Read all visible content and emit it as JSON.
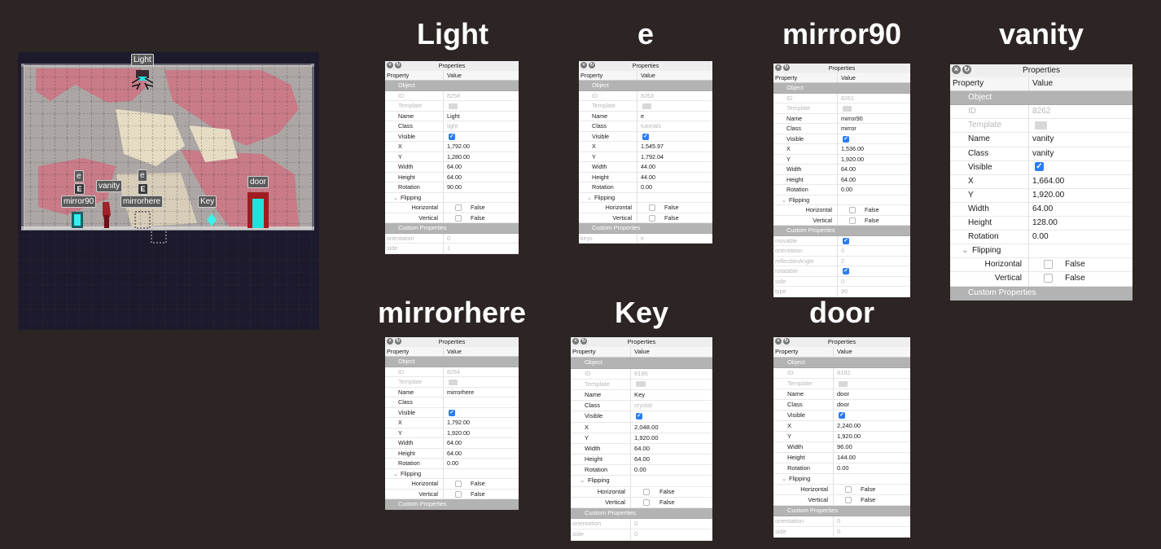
{
  "map": {
    "labels": {
      "light": "Light",
      "e1": "e",
      "e2": "e",
      "key_hint1": "E",
      "key_hint2": "E",
      "vanity": "vanity",
      "mirror90": "mirror90",
      "mirrorhere": "mirrorhere",
      "key": "Key",
      "door": "door"
    },
    "colors": {
      "bg": "#1c1a2c",
      "wall": "#aca7a4",
      "pink": "#c97b88",
      "cream": "#e6dcc4"
    }
  },
  "common": {
    "window_title": "Properties",
    "col_property": "Property",
    "col_value": "Value",
    "sec_object": "Object",
    "sec_custom": "Custom Properties",
    "l_id": "ID",
    "l_template": "Template",
    "l_name": "Name",
    "l_class": "Class",
    "l_visible": "Visible",
    "l_x": "X",
    "l_y": "Y",
    "l_width": "Width",
    "l_height": "Height",
    "l_rotation": "Rotation",
    "l_flipping": "Flipping",
    "l_horizontal": "Horizontal",
    "l_vertical": "Vertical",
    "v_false": "False"
  },
  "panels": {
    "light": {
      "heading": "Light",
      "id": "8258",
      "name": "Light",
      "class": "light",
      "visible": true,
      "x": "1,792.00",
      "y": "1,280.00",
      "width": "64.00",
      "height": "64.00",
      "rotation": "90.00",
      "custom": [
        {
          "k": "orientation",
          "v": "0",
          "chk": false
        },
        {
          "k": "side",
          "v": "1",
          "chk": false
        }
      ]
    },
    "e": {
      "heading": "e",
      "id": "8263",
      "name": "e",
      "class": "tutorials",
      "visible": true,
      "x": "1,545.97",
      "y": "1,792.04",
      "width": "44.00",
      "height": "44.00",
      "rotation": "0.00",
      "custom": [
        {
          "k": "keys",
          "v": "e",
          "chk": false
        }
      ]
    },
    "mirror90": {
      "heading": "mirror90",
      "id": "8261",
      "name": "mirror90",
      "class": "mirror",
      "visible": true,
      "x": "1,536.00",
      "y": "1,920.00",
      "width": "64.00",
      "height": "64.00",
      "rotation": "0.00",
      "custom": [
        {
          "k": "movable",
          "v": "",
          "chk": true
        },
        {
          "k": "orientation",
          "v": "0",
          "chk": false
        },
        {
          "k": "reflectionAngle",
          "v": "2",
          "chk": false
        },
        {
          "k": "rotatable",
          "v": "",
          "chk": true
        },
        {
          "k": "side",
          "v": "0",
          "chk": false
        },
        {
          "k": "type",
          "v": "90",
          "chk": false
        }
      ]
    },
    "vanity": {
      "heading": "vanity",
      "id": "8262",
      "name": "vanity",
      "class": "vanity",
      "visible": true,
      "x": "1,664.00",
      "y": "1,920.00",
      "width": "64.00",
      "height": "128.00",
      "rotation": "0.00",
      "custom": []
    },
    "mirrorhere": {
      "heading": "mirrorhere",
      "id": "8264",
      "name": "mirrorhere",
      "class": "",
      "visible": true,
      "x": "1,792.00",
      "y": "1,920.00",
      "width": "64.00",
      "height": "64.00",
      "rotation": "0.00",
      "custom": []
    },
    "key": {
      "heading": "Key",
      "id": "8186",
      "name": "Key",
      "class": "crystal",
      "visible": true,
      "x": "2,048.00",
      "y": "1,920.00",
      "width": "64.00",
      "height": "64.00",
      "rotation": "0.00",
      "custom": [
        {
          "k": "orientation",
          "v": "0",
          "chk": false
        },
        {
          "k": "side",
          "v": "0",
          "chk": false
        }
      ]
    },
    "door": {
      "heading": "door",
      "id": "8182",
      "name": "door",
      "class": "door",
      "visible": true,
      "x": "2,240.00",
      "y": "1,920.00",
      "width": "96.00",
      "height": "144.00",
      "rotation": "0.00",
      "custom": [
        {
          "k": "orientation",
          "v": "0",
          "chk": false
        },
        {
          "k": "side",
          "v": "0",
          "chk": false
        }
      ]
    }
  }
}
